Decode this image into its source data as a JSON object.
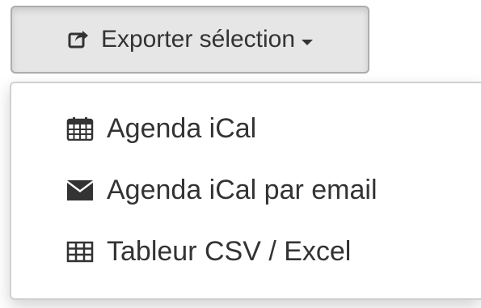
{
  "export_button": {
    "label": "Exporter sélection",
    "icon": "share-square-icon"
  },
  "dropdown": {
    "items": [
      {
        "label": "Agenda iCal",
        "icon": "calendar-icon"
      },
      {
        "label": "Agenda iCal par email",
        "icon": "envelope-icon"
      },
      {
        "label": "Tableur CSV / Excel",
        "icon": "table-icon"
      }
    ]
  },
  "colors": {
    "button_bg": "#e6e6e6",
    "button_border": "#adadad",
    "text": "#333333",
    "menu_border": "#d0d0d0"
  }
}
